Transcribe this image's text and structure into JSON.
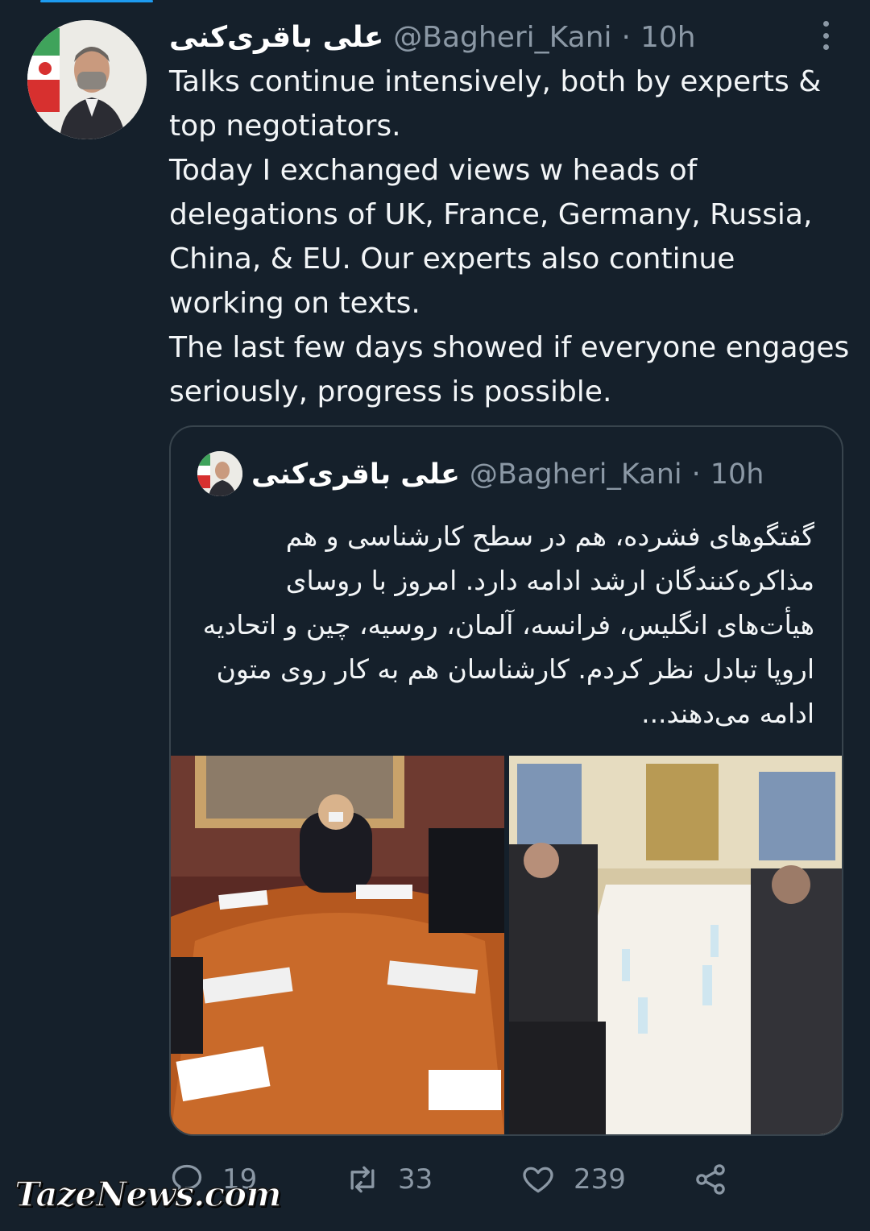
{
  "tweet": {
    "author_name": "علی باقری‌کنی",
    "author_handle": "@Bagheri_Kani",
    "separator": "·",
    "time": "10h",
    "text": "Talks continue intensively, both by experts &\ntop negotiators.\nToday I exchanged views w heads of\ndelegations of UK, France, Germany, Russia,\nChina, & EU. Our experts also continue\nworking on texts.\nThe last few days showed if everyone engages\nseriously, progress is possible."
  },
  "quoted_tweet": {
    "author_name": "علی باقری‌کنی",
    "author_handle": "@Bagheri_Kani",
    "separator": "·",
    "time": "10h",
    "text": "گفتگوهای فشرده، هم در سطح کارشناسی و هم مذاکره‌کنندگان ارشد ادامه دارد. امروز با روسای هیأت‌های انگلیس، فرانسه، آلمان، روسیه، چین و اتحادیه اروپا تبادل نظر کردم. کارشناسان هم به کار روی متون ادامه می‌دهند..."
  },
  "actions": {
    "reply_count": "19",
    "retweet_count": "33",
    "like_count": "239"
  },
  "icons": {
    "more": "more-vertical-icon",
    "reply": "reply-icon",
    "retweet": "retweet-icon",
    "like": "heart-icon",
    "share": "share-icon"
  },
  "watermark": "TazeNews.com",
  "colors": {
    "background": "#15202b",
    "secondary_text": "#8b98a5",
    "border": "#38444d",
    "accent": "#1d9bf0"
  }
}
